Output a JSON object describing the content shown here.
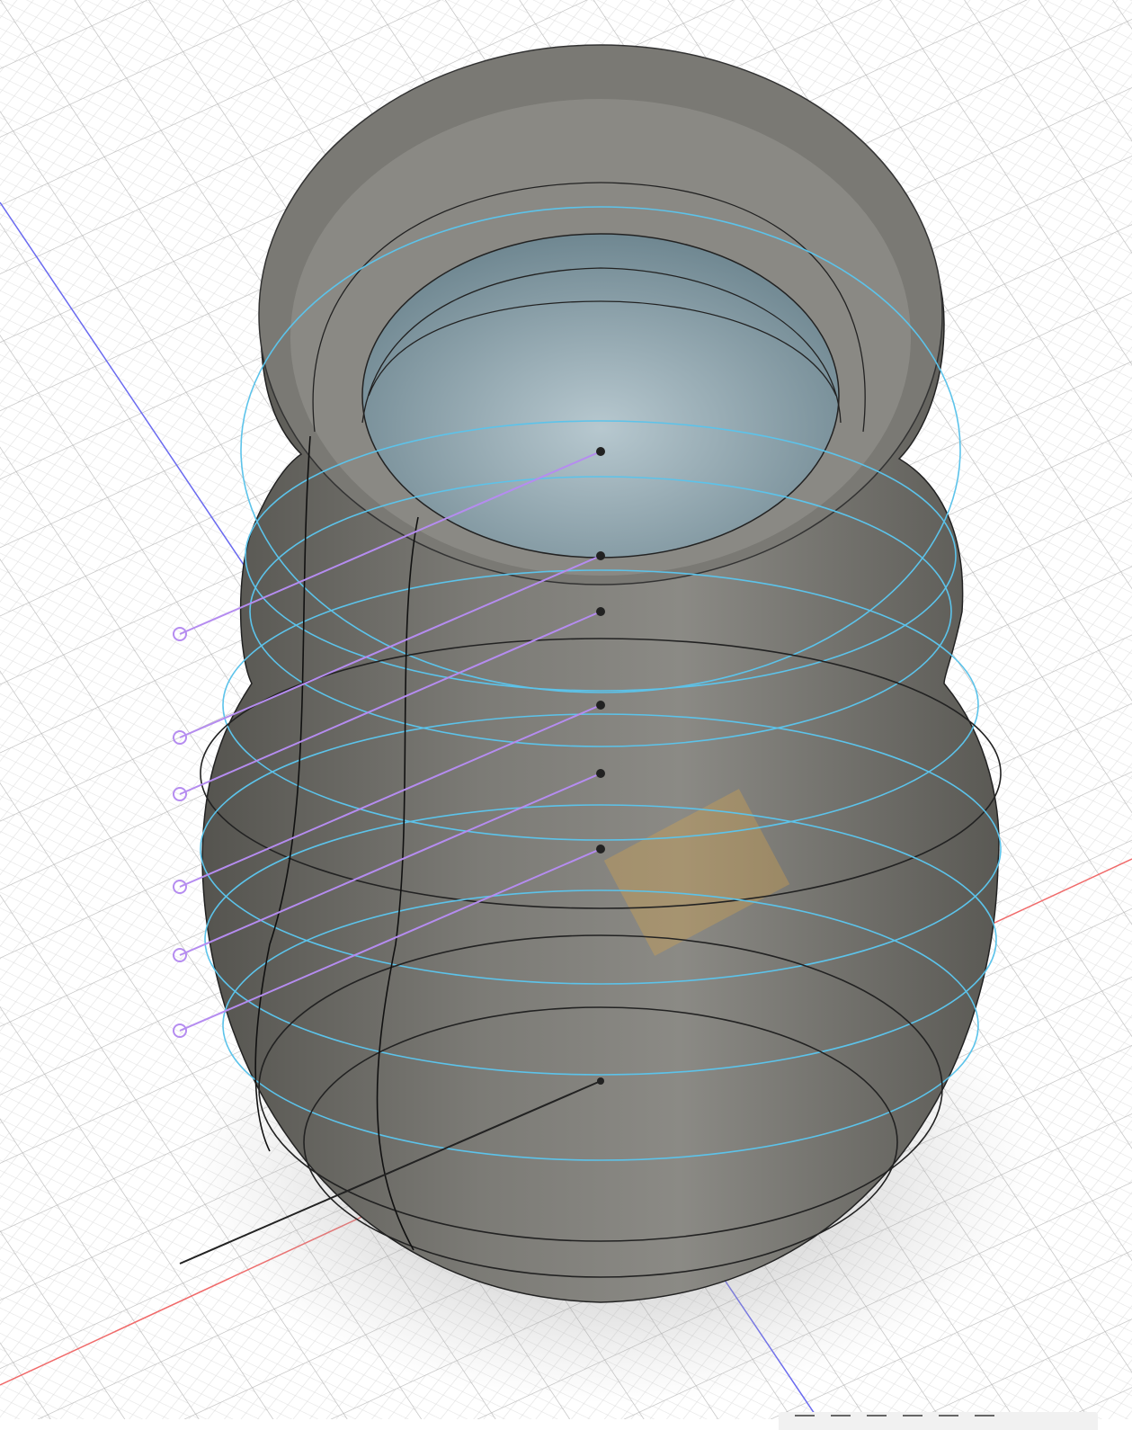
{
  "viewport": {
    "colors": {
      "body": "#6f6e69",
      "section_ring": "#5cc3ea",
      "guide_line": "#b58cf0",
      "x_axis": "#f06a6a",
      "z_axis": "#6a6af0",
      "sketch_plane": "#d9a64a"
    }
  },
  "toolbar": {
    "icons": [
      "orbit-icon",
      "pan-icon",
      "zoom-icon",
      "fit-icon",
      "display-settings-icon",
      "grid-settings-icon"
    ]
  }
}
